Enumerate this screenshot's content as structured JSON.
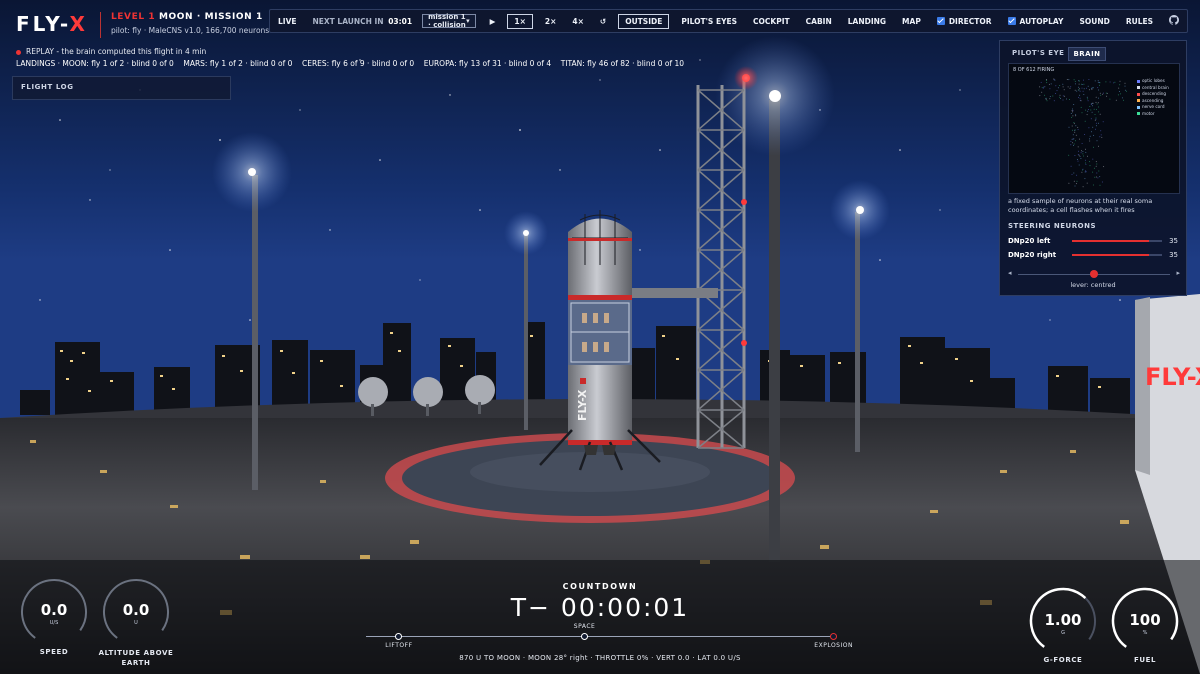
{
  "brand": {
    "logo_main": "FLY-",
    "logo_accent": "X",
    "level_prefix": "LEVEL 1",
    "level_rest": " MOON · MISSION 1",
    "pilot_info": "pilot: fly · MaleCNS v1.0, 166,700 neurons"
  },
  "replay_text": "REPLAY - the brain computed this flight in 4 min",
  "landings_text": "LANDINGS · MOON: fly 1 of 2 · blind 0 of 0    MARS: fly 1 of 2 · blind 0 of 0    CERES: fly 6 of 9 · blind 0 of 0    EUROPA: fly 13 of 31 · blind 0 of 4    TITAN: fly 46 of 82 · blind 0 of 10",
  "flight_log_label": "FLIGHT LOG",
  "toolbar": {
    "live": "LIVE",
    "next_launch_label": "NEXT LAUNCH IN",
    "next_launch_time": "03:01",
    "mission_select": "mission 1 · collision",
    "play_icon": "play-icon",
    "speeds": [
      "1×",
      "2×",
      "4×"
    ],
    "active_speed": "1×",
    "reset_icon": "reset-icon",
    "views": [
      "OUTSIDE",
      "PILOT'S EYES",
      "COCKPIT",
      "CABIN",
      "LANDING",
      "MAP"
    ],
    "active_view": "OUTSIDE",
    "director_label": "DIRECTOR",
    "autoplay_label": "AUTOPLAY",
    "sound_label": "SOUND",
    "rules_label": "RULES",
    "github_icon": "github-icon"
  },
  "panel": {
    "tabs": [
      "PILOT'S EYE",
      "BRAIN"
    ],
    "active_tab": "BRAIN",
    "firing_text": "8 OF 612 FIRING",
    "legend": [
      {
        "label": "optic lobes",
        "color": "#6b7cff"
      },
      {
        "label": "central brain",
        "color": "#d9dde8"
      },
      {
        "label": "descending",
        "color": "#ff4d4d"
      },
      {
        "label": "ascending",
        "color": "#ffb24d"
      },
      {
        "label": "nerve cord",
        "color": "#7fc3ff"
      },
      {
        "label": "motor",
        "color": "#3ddc97"
      }
    ],
    "caption": "a fixed sample of neurons at their real soma coordinates; a cell flashes when it fires",
    "steering_title": "STEERING NEURONS",
    "neurons": [
      {
        "name": "DNp20 left",
        "value": "35",
        "level": 0.85
      },
      {
        "name": "DNp20 right",
        "value": "35",
        "level": 0.85
      }
    ],
    "lever_label": "lever: centred",
    "lever_position": 0.5
  },
  "gauges": {
    "speed": {
      "value": "0.0",
      "unit": "U/S",
      "label": "SPEED"
    },
    "altitude": {
      "value": "0.0",
      "unit": "U",
      "label_line1": "ALTITUDE ABOVE",
      "label_line2": "EARTH"
    },
    "gforce": {
      "value": "1.00",
      "unit": "G",
      "label": "G-FORCE",
      "level": 0.7
    },
    "fuel": {
      "value": "100",
      "unit": "%",
      "label": "FUEL",
      "level": 1.0
    }
  },
  "countdown": {
    "title": "COUNTDOWN",
    "time": "T− 00:00:01",
    "timeline": [
      {
        "label": "LIFTOFF",
        "position": 0.07
      },
      {
        "label": "SPACE",
        "position": 0.465
      },
      {
        "label": "EXPLOSION",
        "position": 0.995
      }
    ],
    "status": "870 U TO MOON · MOON 28° right · THROTTLE 0% · VERT 0.0 · LAT 0.0 U/S"
  },
  "scene": {
    "billboard_text": "FLY-X",
    "rocket_text": "FLY-X"
  },
  "colors": {
    "accent": "#e53030",
    "panel_bg": "#0c142a",
    "checkbox": "#3a7be8"
  }
}
